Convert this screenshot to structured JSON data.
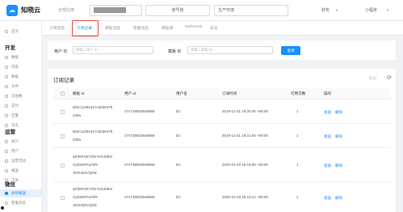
{
  "header": {
    "logo_text": "知晓云",
    "app_label": "全部应用",
    "account_label": "账号账",
    "env_label": "生产环境",
    "finance": "财务",
    "user": "小程序"
  },
  "sidebar": {
    "home": "首页",
    "dev_heading": "开发",
    "dev_items": [
      "数据",
      "内容",
      "数据",
      "文件",
      "云函数",
      "支付",
      "告警",
      "日志"
    ],
    "ops_heading": "运营",
    "ops_items": [
      "统计",
      "用户",
      "运营活动",
      "推送",
      "工具"
    ],
    "wechat_heading": "微信",
    "wechat_items": [
      "知晓推送",
      "客服消息"
    ]
  },
  "tabs": [
    "订阅消息",
    "订阅记录",
    "模板消息",
    "客服消息",
    "模板库",
    "WebHook",
    "日志"
  ],
  "filter": {
    "user_id_label": "用户 ID",
    "user_id_placeholder": "请输入用户 ID",
    "template_id_label": "模板 ID",
    "template_id_placeholder": "请输入模板 ID",
    "search_button": "查询"
  },
  "records": {
    "title": "订阅记录",
    "export_label": "导出",
    "columns": [
      "模板 id",
      "用户 id",
      "用户名",
      "订阅时间",
      "可用次数",
      "操作"
    ],
    "rows": [
      {
        "tpl_line1": "5b4c1128e317c5036479",
        "tpl_line2": "228a",
        "user_id": "274738503848868",
        "username": "bC",
        "time": "2019-12-31 18:20:36 +08:00",
        "count": "1",
        "send": "发送",
        "delete": "删除"
      },
      {
        "tpl_line1": "5b4c1128e317c5036479",
        "tpl_line2": "228a",
        "user_id": "274738503848868",
        "username": "bC",
        "time": "2019-12-31 18:21:54 +08:00",
        "count": "1",
        "send": "发送",
        "delete": "删除"
      },
      {
        "tpl_line1": "qR36PUk71ftrrYeSJ0Bm",
        "tpl_line2": "Cp03eRFwzhR-",
        "tpl_line3": "J6OHbZVzjiXE",
        "user_id": "274738503848868",
        "username": "bC",
        "time": "2020-01-03 15:19:08 +08:00",
        "count": "1",
        "send": "发送",
        "delete": "删除"
      },
      {
        "tpl_line1": "qR36PUk71ftrrYeSJ0Bm",
        "tpl_line2": "Cp03eRFwzhR-",
        "tpl_line3": "J6OHbZVzjiXE",
        "user_id": "274738503848868",
        "username": "bC",
        "time": "2020-01-03 15:19:12 +08:00",
        "count": "1",
        "send": "发送",
        "delete": "删除"
      }
    ]
  }
}
